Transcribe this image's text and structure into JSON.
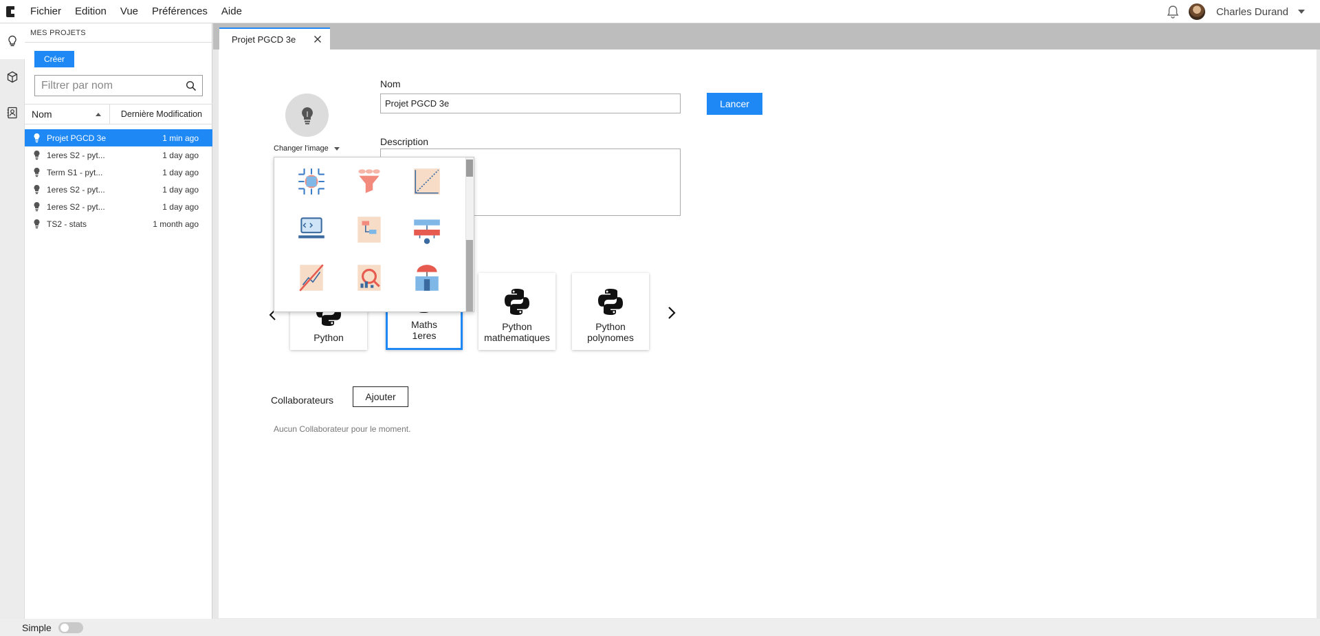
{
  "menu": {
    "items": [
      "Fichier",
      "Edition",
      "Vue",
      "Préférences",
      "Aide"
    ],
    "user_name": "Charles Durand"
  },
  "sidebar": {
    "title": "MES  PROJETS",
    "create_label": "Créer",
    "filter_placeholder": "Filtrer par nom",
    "columns": {
      "name": "Nom",
      "date": "Dernière Modification"
    },
    "projects": [
      {
        "name": "Projet PGCD 3e",
        "date": "1 min ago",
        "selected": true
      },
      {
        "name": "1eres S2 - pyt...",
        "date": "1 day ago"
      },
      {
        "name": "Term S1 - pyt...",
        "date": "1 day ago"
      },
      {
        "name": "1eres S2 - pyt...",
        "date": "1 day ago"
      },
      {
        "name": "1eres S2 - pyt...",
        "date": "1 day ago"
      },
      {
        "name": "TS2 - stats",
        "date": "1 month ago"
      }
    ]
  },
  "tab": {
    "title": "Projet PGCD 3e"
  },
  "form": {
    "change_image_label": "Changer l'image",
    "name_label": "Nom",
    "name_value": "Projet PGCD 3e",
    "launch_label": "Lancer",
    "description_label": "Description",
    "description_value": ""
  },
  "templates": [
    {
      "name": "Python",
      "selected": false
    },
    {
      "name": "Maths\n1eres",
      "selected": true
    },
    {
      "name": "Python\nmathematiques",
      "selected": false
    },
    {
      "name": "Python\npolynomes",
      "selected": false
    }
  ],
  "collaborators": {
    "label": "Collaborateurs",
    "add_label": "Ajouter",
    "empty_text": "Aucun Collaborateur pour le moment."
  },
  "image_picker": {
    "icons": [
      "chip-icon",
      "funnel-icon",
      "line-chart-icon",
      "map-pin-icon",
      "laptop-code-icon",
      "flowchart-doc-icon",
      "network-diagram-icon",
      "people-flow-icon",
      "no-chart-icon",
      "chart-magnifier-icon",
      "building-umbrella-icon",
      "robot-icon"
    ]
  },
  "footer": {
    "mode_label": "Simple"
  },
  "colors": {
    "accent": "#1e88f5",
    "tabbar": "#bdbdbd"
  }
}
